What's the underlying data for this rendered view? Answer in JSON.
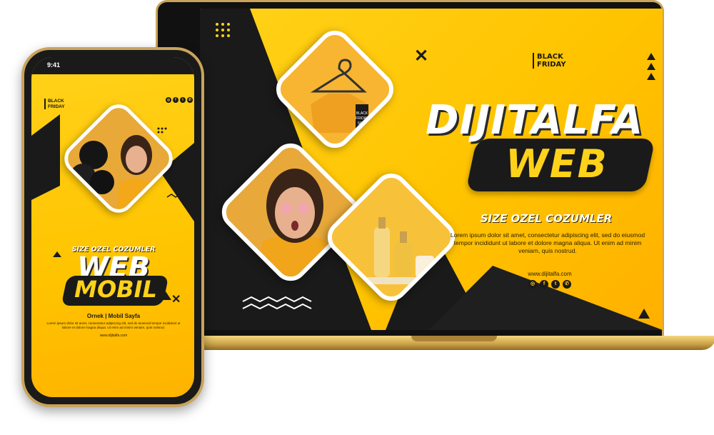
{
  "laptop": {
    "badge": [
      "BLACK",
      "FRIDAY"
    ],
    "title": "DIJITALFA",
    "title_accent": "WEB",
    "subtitle": "SIZE OZEL COZUMLER",
    "body": "Lorem ipsum dolor sit amet, consectetur adipiscing elit, sed do eiusmod tempor incididunt ut labore et dolore magna aliqua. Ut enim ad minim veniam, quis nostrud.",
    "url": "www.dijitalfa.com",
    "social_icons": [
      "instagram-icon",
      "facebook-icon",
      "twitter-icon",
      "whatsapp-icon"
    ],
    "tag": [
      "BLACK",
      "FRIDAY",
      "SALE"
    ]
  },
  "phone": {
    "status_time": "9:41",
    "badge": [
      "BLACK",
      "FRIDAY"
    ],
    "subtitle": "SIZE OZEL COZUMLER",
    "title": "WEB",
    "title_accent": "MOBIL",
    "caption": "Ornek | Mobil Sayfa",
    "body": "Lorem ipsum dolor sit amet, consectetur adipiscing elit, sed do eiusmod tempor incididunt ut labore et dolore magna aliqua. Ut enim ad minim veniam, quis nostrud.",
    "url": "www.dijitalfa.com",
    "social_icons": [
      "instagram-icon",
      "facebook-icon",
      "twitter-icon",
      "whatsapp-icon"
    ]
  },
  "colors": {
    "accent": "#ffc400",
    "dark": "#1a1a1a",
    "frame_gold": "#c9a45a"
  }
}
